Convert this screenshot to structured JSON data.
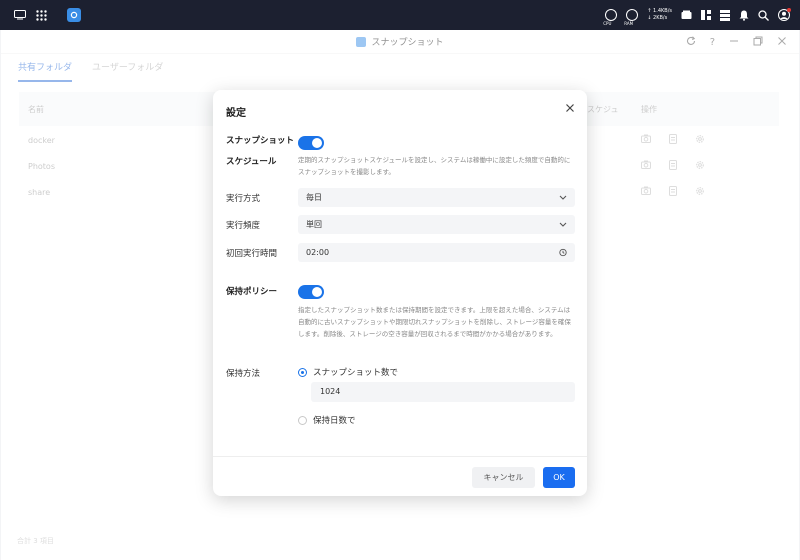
{
  "sysbar": {
    "gauge_cpu": "CPU",
    "gauge_ram": "RAM",
    "net_up": "↑ 1.4KB/s",
    "net_down": "↓ 2KB/s"
  },
  "window": {
    "title": "スナップショット"
  },
  "tabs": [
    {
      "label": "共有フォルダ",
      "active": true
    },
    {
      "label": "ユーザーフォルダ",
      "active": false
    }
  ],
  "table": {
    "col_name": "名前",
    "col_schedule": "スケジュ",
    "col_actions": "操作",
    "rows": [
      {
        "name": "docker"
      },
      {
        "name": "Photos"
      },
      {
        "name": "share"
      }
    ],
    "footer": "合計 3 項目"
  },
  "dialog": {
    "title": "設定",
    "snapshot_schedule_label": "スナップショットスケジュール",
    "snapshot_schedule_enabled": true,
    "snapshot_schedule_desc": "定期的スナップショットスケジュールを設定し、システムは稼働中に設定した頻度で自動的にスナップショットを撮影します。",
    "exec_mode_label": "実行方式",
    "exec_mode_value": "毎日",
    "exec_freq_label": "実行頻度",
    "exec_freq_value": "単回",
    "first_time_label": "初回実行時間",
    "first_time_value": "02:00",
    "retention_label": "保持ポリシー",
    "retention_enabled": true,
    "retention_desc": "指定したスナップショット数または保持期間を設定できます。上限を超えた場合、システムは自動的に古いスナップショットや期限切れスナップショットを削除し、ストレージ容量を確保します。削除後、ストレージの空き容量が回収されるまで時間がかかる場合があります。",
    "retention_method_label": "保持方法",
    "option_count_label": "スナップショット数で",
    "option_count_value": "1024",
    "option_days_label": "保持日数で",
    "selected_option": "count",
    "cancel_label": "キャンセル",
    "ok_label": "OK"
  },
  "colors": {
    "accent": "#1a6df0",
    "topbar": "#1c2030"
  }
}
